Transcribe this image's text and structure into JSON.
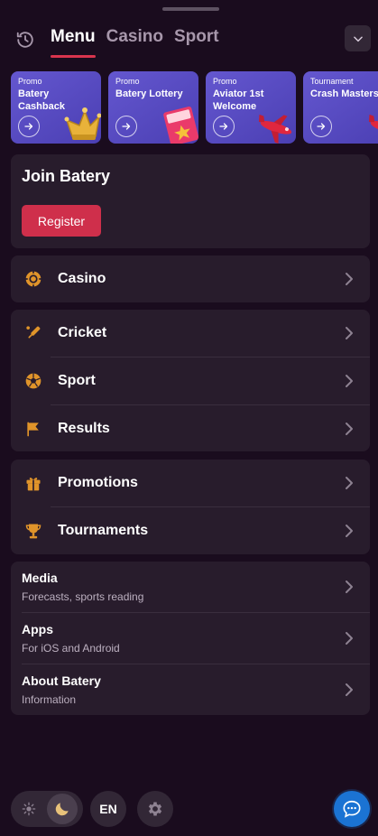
{
  "header": {
    "tabs": [
      {
        "label": "Menu",
        "active": true
      },
      {
        "label": "Casino",
        "active": false
      },
      {
        "label": "Sport",
        "active": false
      }
    ]
  },
  "promos": [
    {
      "tag": "Promo",
      "title": "Batery\nCashback",
      "art": "crown"
    },
    {
      "tag": "Promo",
      "title": "Batery Lottery",
      "art": "lottery-ticket"
    },
    {
      "tag": "Promo",
      "title": "Aviator 1st\nWelcome",
      "art": "plane"
    },
    {
      "tag": "Tournament",
      "title": "Crash Masters",
      "art": "plane"
    }
  ],
  "join": {
    "title": "Join Batery",
    "register_label": "Register"
  },
  "menu_groups": {
    "casino": [
      {
        "label": "Casino",
        "icon": "casino-chip-icon"
      }
    ],
    "sports": [
      {
        "label": "Cricket",
        "icon": "cricket-bat-icon"
      },
      {
        "label": "Sport",
        "icon": "soccer-ball-icon"
      },
      {
        "label": "Results",
        "icon": "flag-icon"
      }
    ],
    "rewards": [
      {
        "label": "Promotions",
        "icon": "gift-icon"
      },
      {
        "label": "Tournaments",
        "icon": "trophy-icon"
      }
    ]
  },
  "info": [
    {
      "title": "Media",
      "subtitle": "Forecasts, sports reading"
    },
    {
      "title": "Apps",
      "subtitle": "For iOS and Android"
    },
    {
      "title": "About Batery",
      "subtitle": "Information"
    }
  ],
  "footer": {
    "language": "EN",
    "theme": "dark"
  },
  "colors": {
    "background": "#1a0c1e",
    "panel": "#281c2c",
    "accent": "#cf2f4b",
    "icon": "#e0942a",
    "promo": "#5a4ec6",
    "chat": "#1b73d3"
  }
}
